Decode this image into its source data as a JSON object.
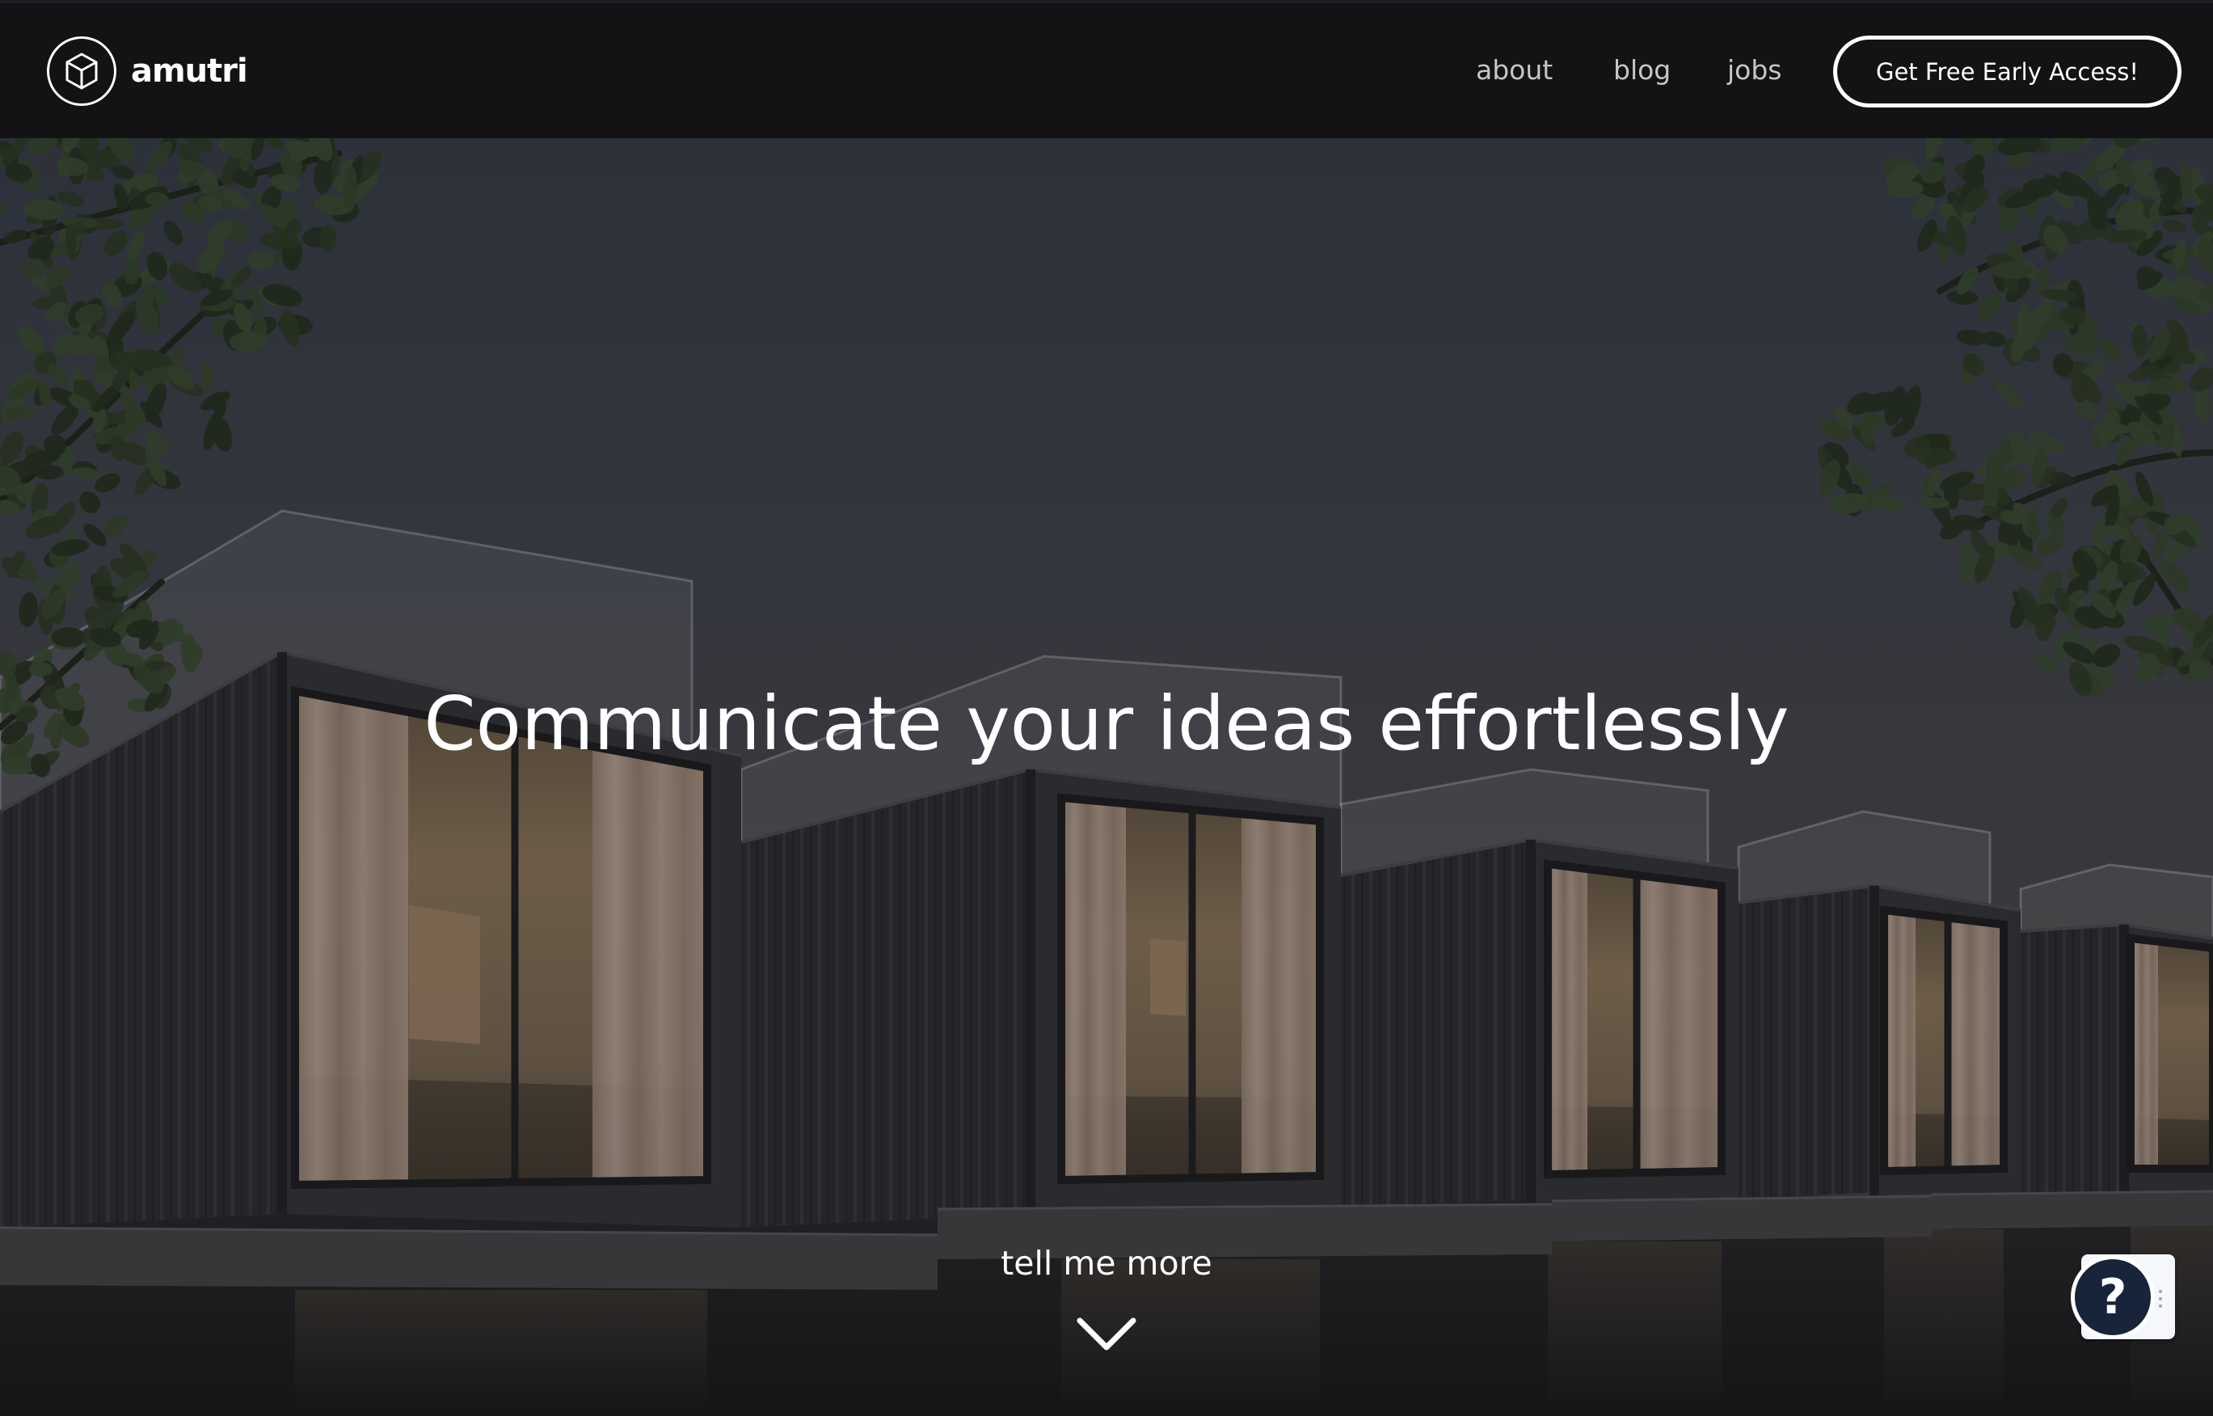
{
  "brand": {
    "name": "amutri",
    "logo_icon": "cube-icon"
  },
  "nav": {
    "links": [
      {
        "label": "about"
      },
      {
        "label": "blog"
      },
      {
        "label": "jobs"
      }
    ],
    "cta": {
      "label": "Get Free Early Access!"
    }
  },
  "hero": {
    "background": "photo-of-lit-container-houses-at-dusk",
    "headline": "Communicate your ideas effortlessly",
    "scroll_cue": {
      "label": "tell me more",
      "icon": "chevron-down-icon"
    }
  },
  "help_widget": {
    "symbol": "?",
    "icon": "question-mark-icon",
    "menu_icon": "vertical-dots-icon"
  },
  "colors": {
    "nav_background": "#131315",
    "text_primary": "#ffffff",
    "nav_link": "#c6c6c6",
    "help_button": "#17243a",
    "help_tab": "#f5f7fa"
  }
}
